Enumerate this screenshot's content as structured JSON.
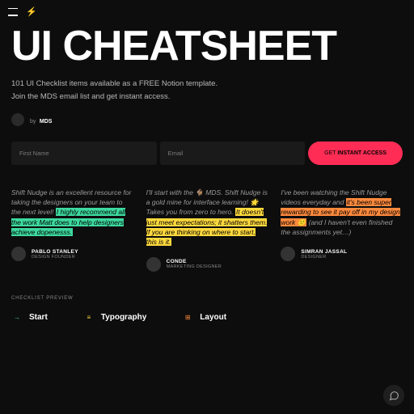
{
  "topbar": {
    "menu": "menu",
    "bolt": "⚡"
  },
  "hero": {
    "title": "UI CHEATSHEET",
    "subtitle_l1": "101 UI Checklist items available as a FREE Notion template.",
    "subtitle_l2": "Join the MDS email list and get instant access.",
    "by": "by",
    "author": "MDS"
  },
  "form": {
    "first_name_placeholder": "First Name",
    "email_placeholder": "Email",
    "cta_prefix": "GET ",
    "cta_strong": "INSTANT ACCESS"
  },
  "testimonials": [
    {
      "pre": "Shift Nudge is an excellent resource for taking the designers on your team to the next level! ",
      "hl": "I highly recommend all the work Matt does to help designers achieve dopenesss.",
      "post": "",
      "hl_class": "hl-green",
      "name": "PABLO STANLEY",
      "role": "DESIGN FOUNDER"
    },
    {
      "pre": "I'll start with the 🐐 MDS. Shift Nudge is a gold mine for interface learning! 🌟 Takes you from zero to hero. ",
      "hl": "It doesn't just meet expectations; it shatters them. If you are thinking on where to start, this is it.",
      "post": "",
      "hl_class": "hl-yellow",
      "name": "CONDE",
      "role": "MARKETING DESIGNER"
    },
    {
      "pre": "I've been watching the Shift Nudge videos everyday and ",
      "hl": "it's been super rewarding to see it pay off in my design work 🙂",
      "post": " (and I haven't even finished the assignments yet…)",
      "hl_class": "hl-orange",
      "name": "SIMRAN JASSAL",
      "role": "DESIGNER"
    }
  ],
  "preview_label": "CHECKLIST PREVIEW",
  "categories": [
    {
      "icon": "→",
      "label": "Start",
      "color": "green"
    },
    {
      "icon": "≡",
      "label": "Typography",
      "color": "yellow"
    },
    {
      "icon": "⊞",
      "label": "Layout",
      "color": "orange"
    }
  ],
  "help": "○"
}
